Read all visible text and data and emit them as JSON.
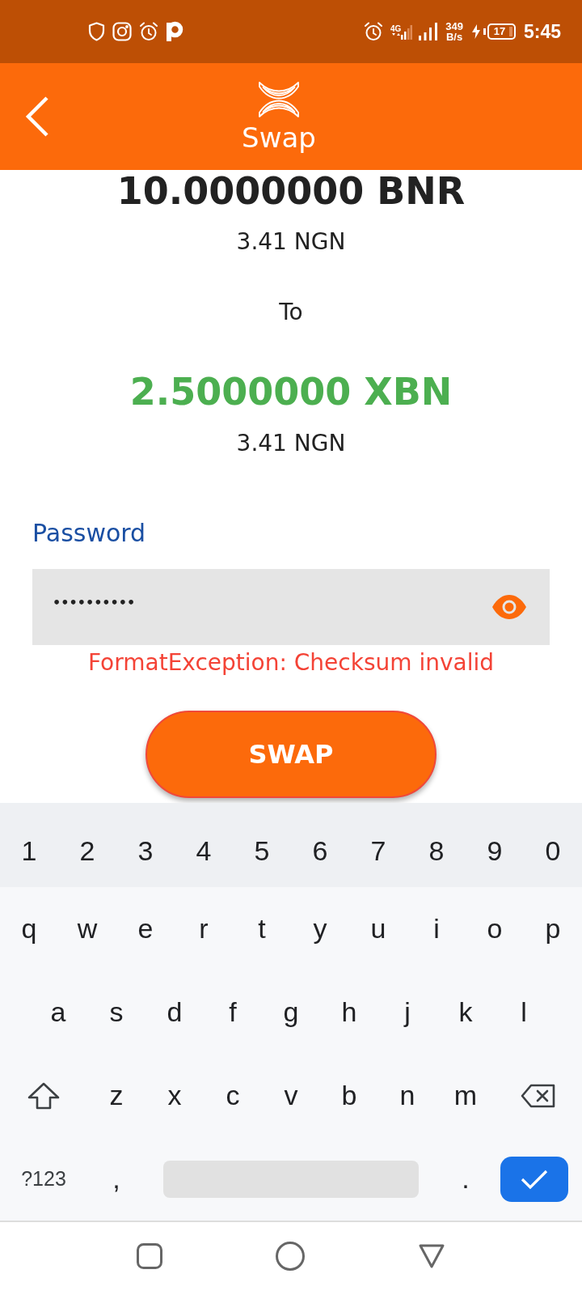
{
  "status_bar": {
    "time": "5:45",
    "network": "4G",
    "speed_value": "349",
    "speed_unit": "B/s",
    "battery": "17"
  },
  "app_bar": {
    "title": "Swap"
  },
  "swap": {
    "from_amount": "10.0000000 BNR",
    "from_fiat": "3.41 NGN",
    "connector": "To",
    "to_amount": "2.5000000 XBN",
    "to_fiat": "3.41 NGN"
  },
  "password": {
    "label": "Password",
    "value": "••••••••••",
    "error": "FormatException: Checksum invalid"
  },
  "swap_button": {
    "label": "SWAP"
  },
  "keyboard": {
    "rows": [
      {
        "kind": "number_row",
        "keys": [
          {
            "kind": "char",
            "label": "1"
          },
          {
            "kind": "char",
            "label": "2"
          },
          {
            "kind": "char",
            "label": "3"
          },
          {
            "kind": "char",
            "label": "4"
          },
          {
            "kind": "char",
            "label": "5"
          },
          {
            "kind": "char",
            "label": "6"
          },
          {
            "kind": "char",
            "label": "7"
          },
          {
            "kind": "char",
            "label": "8"
          },
          {
            "kind": "char",
            "label": "9"
          },
          {
            "kind": "char",
            "label": "0"
          }
        ]
      },
      {
        "kind": "letter_row",
        "keys": [
          {
            "kind": "char",
            "label": "q"
          },
          {
            "kind": "char",
            "label": "w"
          },
          {
            "kind": "char",
            "label": "e"
          },
          {
            "kind": "char",
            "label": "r"
          },
          {
            "kind": "char",
            "label": "t"
          },
          {
            "kind": "char",
            "label": "y"
          },
          {
            "kind": "char",
            "label": "u"
          },
          {
            "kind": "char",
            "label": "i"
          },
          {
            "kind": "char",
            "label": "o"
          },
          {
            "kind": "char",
            "label": "p"
          }
        ]
      },
      {
        "kind": "letter_row",
        "keys": [
          {
            "kind": "char",
            "label": "a"
          },
          {
            "kind": "char",
            "label": "s"
          },
          {
            "kind": "char",
            "label": "d"
          },
          {
            "kind": "char",
            "label": "f"
          },
          {
            "kind": "char",
            "label": "g"
          },
          {
            "kind": "char",
            "label": "h"
          },
          {
            "kind": "char",
            "label": "j"
          },
          {
            "kind": "char",
            "label": "k"
          },
          {
            "kind": "char",
            "label": "l"
          }
        ]
      },
      {
        "kind": "letter_row",
        "keys": [
          {
            "kind": "shift"
          },
          {
            "kind": "char",
            "label": "z"
          },
          {
            "kind": "char",
            "label": "x"
          },
          {
            "kind": "char",
            "label": "c"
          },
          {
            "kind": "char",
            "label": "v"
          },
          {
            "kind": "char",
            "label": "b"
          },
          {
            "kind": "char",
            "label": "n"
          },
          {
            "kind": "char",
            "label": "m"
          },
          {
            "kind": "backspace"
          }
        ]
      },
      {
        "kind": "letter_row",
        "keys": [
          {
            "kind": "mode",
            "label": "?123"
          },
          {
            "kind": "char",
            "label": ","
          },
          {
            "kind": "space"
          },
          {
            "kind": "char",
            "label": "."
          },
          {
            "kind": "enter"
          }
        ]
      }
    ]
  }
}
